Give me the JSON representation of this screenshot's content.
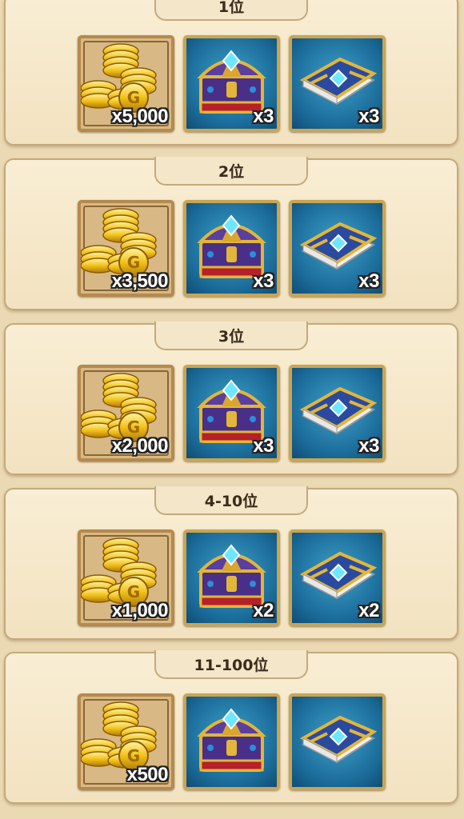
{
  "tiers": [
    {
      "rank": "1位",
      "rewards": [
        {
          "kind": "coin",
          "icon": "gold-coins-icon",
          "qty": "x5,000"
        },
        {
          "kind": "chest",
          "icon": "treasure-chest-icon",
          "qty": "x3"
        },
        {
          "kind": "book",
          "icon": "spell-book-icon",
          "qty": "x3"
        }
      ]
    },
    {
      "rank": "2位",
      "rewards": [
        {
          "kind": "coin",
          "icon": "gold-coins-icon",
          "qty": "x3,500"
        },
        {
          "kind": "chest",
          "icon": "treasure-chest-icon",
          "qty": "x3"
        },
        {
          "kind": "book",
          "icon": "spell-book-icon",
          "qty": "x3"
        }
      ]
    },
    {
      "rank": "3位",
      "rewards": [
        {
          "kind": "coin",
          "icon": "gold-coins-icon",
          "qty": "x2,000"
        },
        {
          "kind": "chest",
          "icon": "treasure-chest-icon",
          "qty": "x3"
        },
        {
          "kind": "book",
          "icon": "spell-book-icon",
          "qty": "x3"
        }
      ]
    },
    {
      "rank": "4-10位",
      "rewards": [
        {
          "kind": "coin",
          "icon": "gold-coins-icon",
          "qty": "x1,000"
        },
        {
          "kind": "chest",
          "icon": "treasure-chest-icon",
          "qty": "x2"
        },
        {
          "kind": "book",
          "icon": "spell-book-icon",
          "qty": "x2"
        }
      ]
    },
    {
      "rank": "11-100位",
      "rewards": [
        {
          "kind": "coin",
          "icon": "gold-coins-icon",
          "qty": "x500"
        },
        {
          "kind": "chest",
          "icon": "treasure-chest-icon",
          "qty": ""
        },
        {
          "kind": "book",
          "icon": "spell-book-icon",
          "qty": ""
        }
      ]
    }
  ],
  "colors": {
    "panel": "#f6e9cc",
    "border": "#c4a97c",
    "frame_gold": "#c8a553",
    "item_blue": "#1a6a98"
  }
}
